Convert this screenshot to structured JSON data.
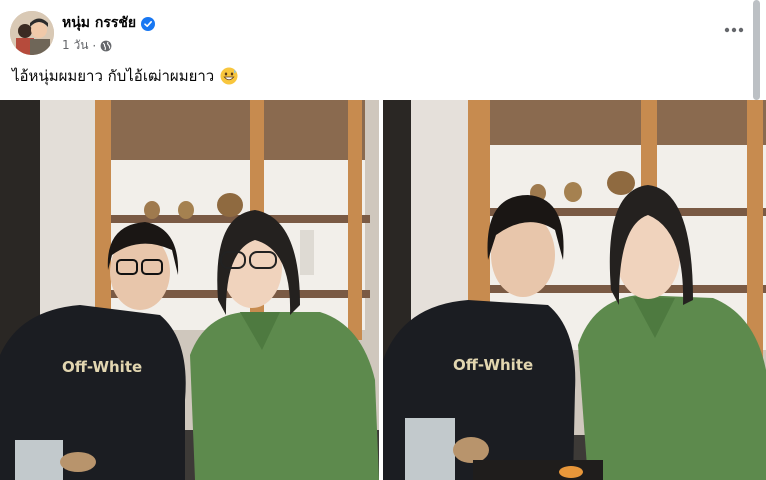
{
  "post": {
    "author": "หนุ่ม กรรชัย",
    "time": "1 วัน",
    "caption": "ไอ้หนุ่มผมยาว กับไอ้เฒ่าผมยาว",
    "caption_emoji": "grinning-sweat-emoji"
  },
  "photos": [
    {
      "name": "photo-left",
      "hoodie_text": "Off-White"
    },
    {
      "name": "photo-right",
      "hoodie_text": "Off-White"
    }
  ],
  "icons": [
    "verified-badge-icon",
    "globe-icon",
    "more-options-icon"
  ],
  "colors": {
    "verified": "#1877f2",
    "meta": "#65676b",
    "hoodie": "#1b1d22",
    "shirt": "#5d8a4d",
    "shelf": "#c78b4f"
  }
}
